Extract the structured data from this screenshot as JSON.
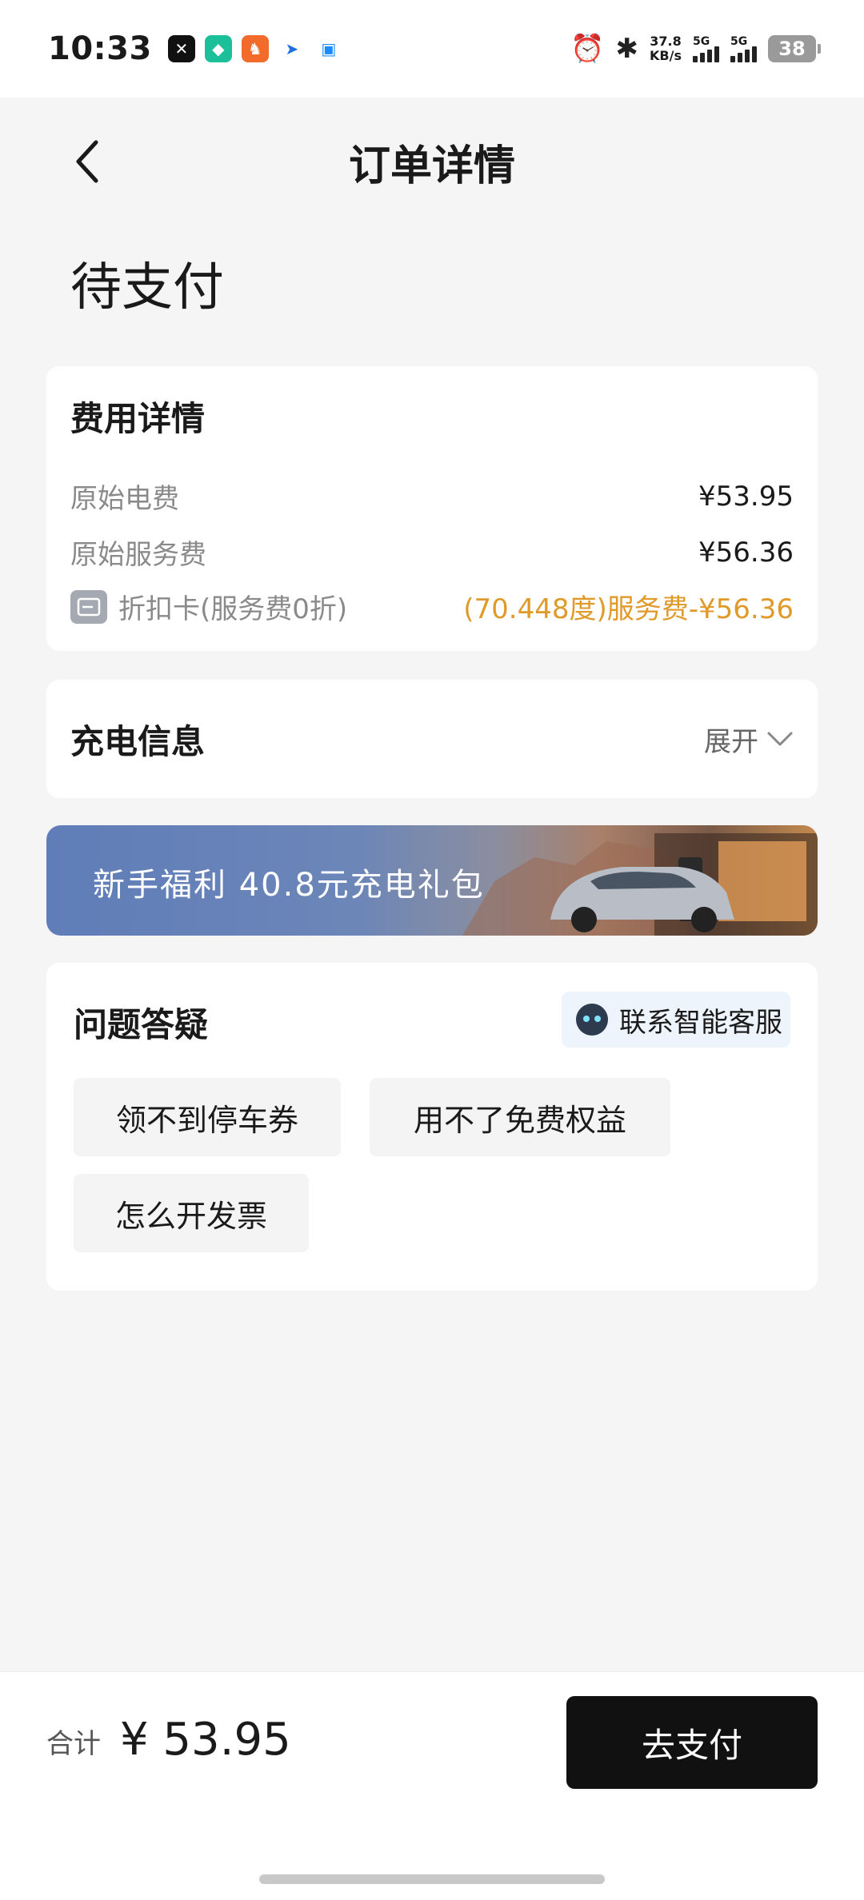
{
  "status_bar": {
    "time": "10:33",
    "netspeed_value": "37.8",
    "netspeed_unit": "KB/s",
    "sim1": "5G",
    "sim2": "5G",
    "battery": "38"
  },
  "header": {
    "title": "订单详情"
  },
  "order_status": "待支付",
  "fee_details": {
    "title": "费用详情",
    "rows": [
      {
        "label": "原始电费",
        "value": "¥53.95"
      },
      {
        "label": "原始服务费",
        "value": "¥56.36"
      }
    ],
    "discount": {
      "label": "折扣卡(服务费0折)",
      "value": "(70.448度)服务费-¥56.36"
    }
  },
  "charge_info": {
    "title": "充电信息",
    "expand_label": "展开"
  },
  "banner": {
    "text": "新手福利 40.8元充电礼包"
  },
  "faq": {
    "title": "问题答疑",
    "support_label": "联系智能客服",
    "chips": [
      "领不到停车券",
      "用不了免费权益",
      "怎么开发票"
    ]
  },
  "footer": {
    "total_label": "合计",
    "total_amount": "¥ 53.95",
    "pay_label": "去支付"
  },
  "colors": {
    "accent_orange": "#e09a2a",
    "pay_button": "#111111"
  }
}
